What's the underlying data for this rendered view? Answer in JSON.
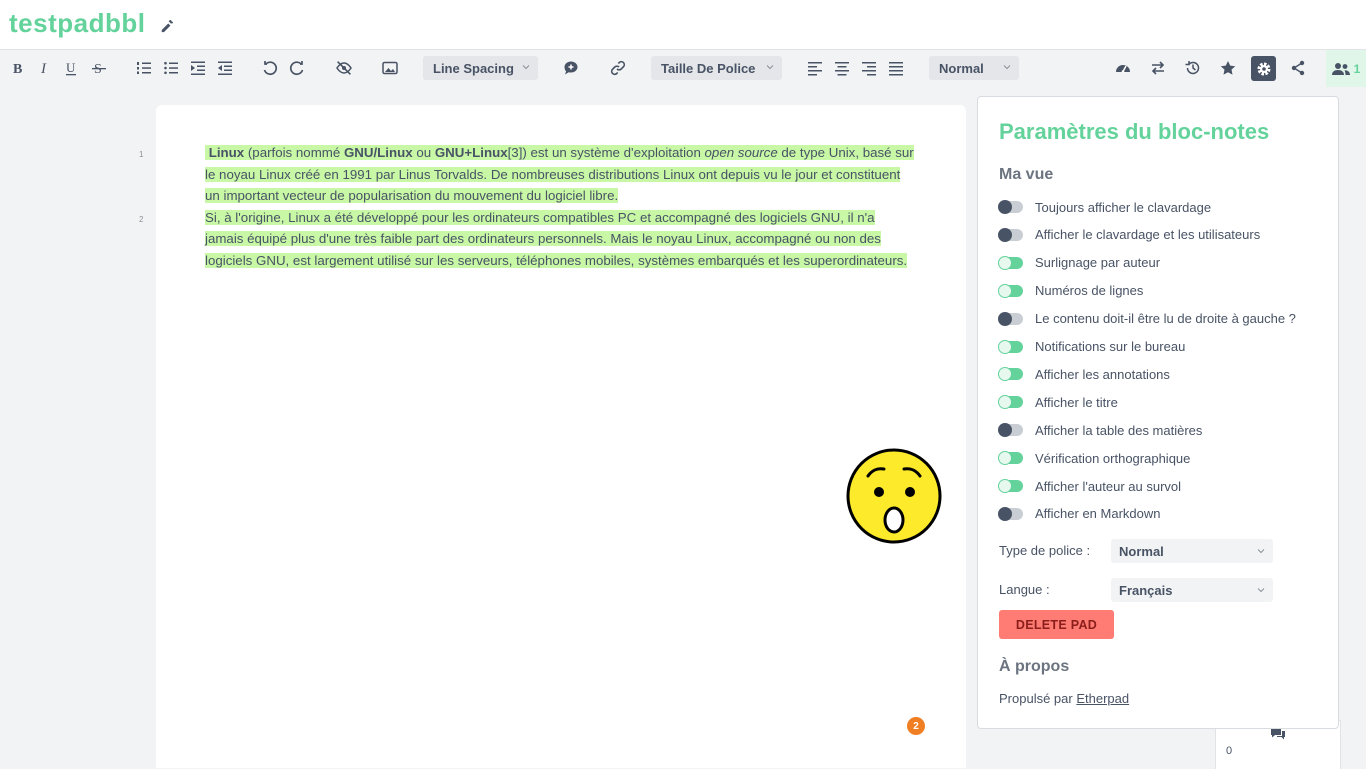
{
  "pad": {
    "title": "testpadbbl"
  },
  "toolbar": {
    "line_spacing": "Line Spacing",
    "font_size": "Taille De Police",
    "heading": "Normal",
    "user_count": "1"
  },
  "editor": {
    "line_numbers": [
      "1",
      "2"
    ],
    "p1": {
      "linux": "Linux",
      "t1": " (parfois nommé ",
      "gnu_linux": "GNU/Linux",
      "t2": " ou ",
      "gnu_plus": "GNU+Linux",
      "t3": "[3]) est un système d'exploitation ",
      "open_source": "open source",
      "t4": " de type Unix, basé sur le noyau Linux créé en 1991 par Linus Torvalds. De nombreuses distributions Linux ont depuis vu le jour et constituent un important vecteur de popularisation du mouvement du logiciel libre."
    },
    "p2": "Si, à l'origine, Linux a été développé pour les ordinateurs compatibles PC et accompagné des logiciels GNU, il n'a jamais équipé plus d'une très faible part des ordinateurs personnels. Mais le noyau Linux, accompagné ou non des logiciels GNU, est largement utilisé sur les serveurs, téléphones mobiles, systèmes embarqués et les superordinateurs.",
    "comment_badge": "2"
  },
  "chat": {
    "count": "0"
  },
  "settings": {
    "title": "Paramètres du bloc-notes",
    "my_view": "Ma vue",
    "options": [
      {
        "label": "Toujours afficher le clavardage",
        "on": false
      },
      {
        "label": "Afficher le clavardage et les utilisateurs",
        "on": false
      },
      {
        "label": "Surlignage par auteur",
        "on": true
      },
      {
        "label": "Numéros de lignes",
        "on": true
      },
      {
        "label": "Le contenu doit-il être lu de droite à gauche ?",
        "on": false
      },
      {
        "label": "Notifications sur le bureau",
        "on": true
      },
      {
        "label": "Afficher les annotations",
        "on": true
      },
      {
        "label": "Afficher le titre",
        "on": true
      },
      {
        "label": "Afficher la table des matières",
        "on": false
      },
      {
        "label": "Vérification orthographique",
        "on": true
      },
      {
        "label": "Afficher l'auteur au survol",
        "on": true
      },
      {
        "label": "Afficher en Markdown",
        "on": false
      }
    ],
    "font_type_label": "Type de police :",
    "font_type_value": "Normal",
    "language_label": "Langue :",
    "language_value": "Français",
    "delete_label": "DELETE PAD",
    "about": "À propos",
    "powered_by": "Propulsé par",
    "etherpad": "Etherpad"
  },
  "colors": {
    "accent": "#64d29b",
    "highlight": "#c8f7a6",
    "danger": "#ff7c74",
    "badge": "#f07f24"
  }
}
